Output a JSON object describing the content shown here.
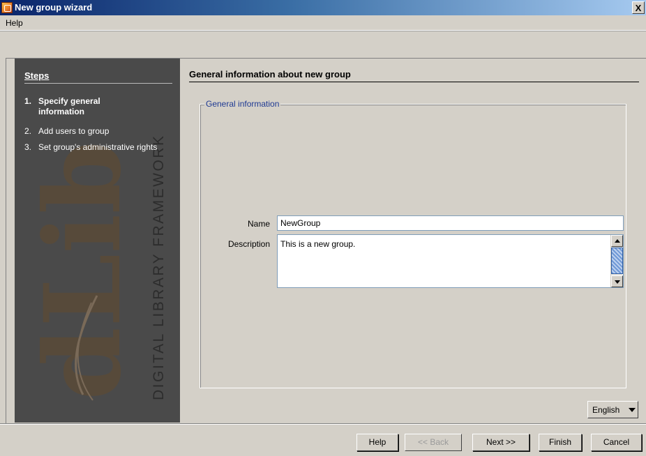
{
  "window": {
    "title": "New group wizard",
    "close_glyph": "X",
    "icon": "app-icon"
  },
  "menu": {
    "items": [
      {
        "label": "Help"
      }
    ]
  },
  "steps": {
    "title": "Steps",
    "items": [
      {
        "num": "1.",
        "label": "Specify general information",
        "active": true
      },
      {
        "num": "2.",
        "label": "Add users to group",
        "active": false
      },
      {
        "num": "3.",
        "label": "Set group's administrative rights",
        "active": false
      }
    ],
    "watermark": {
      "logo": "dLib",
      "framework_text": "DIGITAL LIBRARY FRAMEWORK"
    }
  },
  "main": {
    "heading": "General information about new group",
    "group_box_label": "General information",
    "fields": {
      "name_label": "Name",
      "name_value": "NewGroup",
      "description_label": "Description",
      "description_value": "This is a new group."
    }
  },
  "language": {
    "selected": "English"
  },
  "buttons": {
    "help": "Help",
    "back": "<< Back",
    "next": "Next >>",
    "finish": "Finish",
    "cancel": "Cancel"
  },
  "colors": {
    "steps_panel_bg": "#4a4a4a",
    "watermark_brown": "#5a4a38",
    "group_box_label": "#1f3a93",
    "titlebar_start": "#0a246a"
  }
}
